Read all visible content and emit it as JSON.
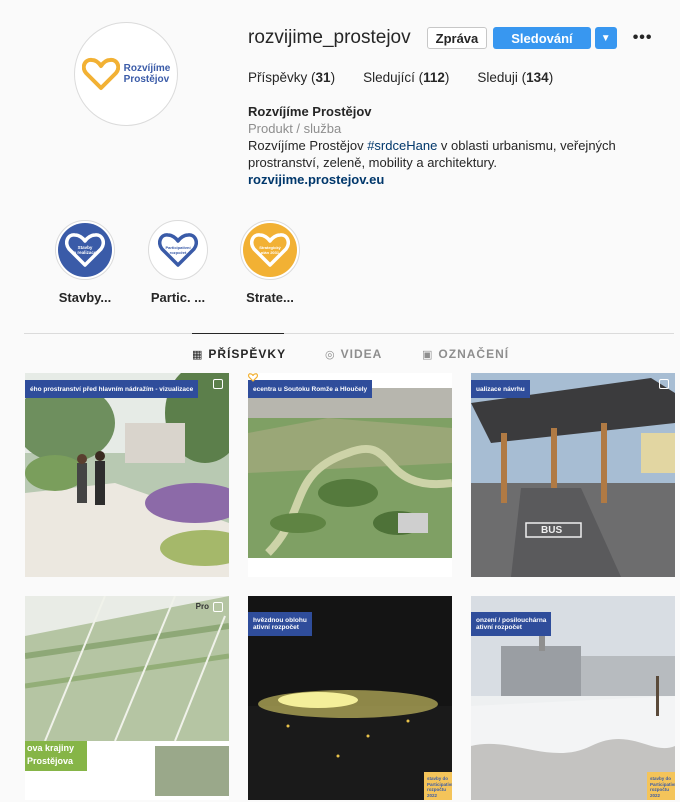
{
  "profile": {
    "username": "rozvijime_prostejov",
    "message_label": "Zpráva",
    "follow_label": "Sledování",
    "logo_text": "Rozvíjíme\nProstějov",
    "stats": [
      {
        "value": "31",
        "label": "Příspěvky"
      },
      {
        "value": "112",
        "label": "Sledující"
      },
      {
        "value": "134",
        "label": "Sleduji"
      }
    ],
    "name": "Rozvíjíme Prostějov",
    "category": "Produkt / služba",
    "bio_before": "Rozvíjíme Prostějov ",
    "bio_hashtag": "#srdceHane",
    "bio_after": " v oblasti urbanismu, veřejných prostranství, zeleně, mobility a architektury.",
    "link": "rozvijime.prostejov.eu"
  },
  "highlights": [
    {
      "label": "Stavby...",
      "inner_text": "Stavby\na realizace",
      "color": "#3a5ba8"
    },
    {
      "label": "Partic. ...",
      "inner_text": "Participativní\nrozpočet",
      "color": "#ffffff"
    },
    {
      "label": "Strate...",
      "inner_text": "Strategický\nplán 2031",
      "color": "#f2b134"
    }
  ],
  "tabs": [
    {
      "label": "PŘÍSPĚVKY",
      "icon": "grid-icon",
      "active": true
    },
    {
      "label": "VIDEA",
      "icon": "video-icon",
      "active": false
    },
    {
      "label": "OZNAČENÍ",
      "icon": "tag-icon",
      "active": false
    }
  ],
  "posts": [
    {
      "caption": "ého prostranství před hlavním nádražím - vizualizace"
    },
    {
      "caption": "ecentra u Soutoku Romže a Hloučely"
    },
    {
      "caption": "ualizace návrhu"
    },
    {
      "caption": "Pro",
      "title1": "ova krajiny",
      "title2": "Prostějova"
    },
    {
      "caption": "hvězdnou oblohu",
      "caption2": "ativní rozpočet",
      "badge": "stavby do Participativní rozpočtu 2022"
    },
    {
      "caption": "onzení / posilouchárna",
      "caption2": "ativní rozpočet",
      "badge": "stavby do Participativní rozpočtu 2022"
    }
  ],
  "colors": {
    "accent": "#3897f0",
    "brand_blue": "#3a5ba8",
    "brand_yellow": "#f2b134"
  }
}
